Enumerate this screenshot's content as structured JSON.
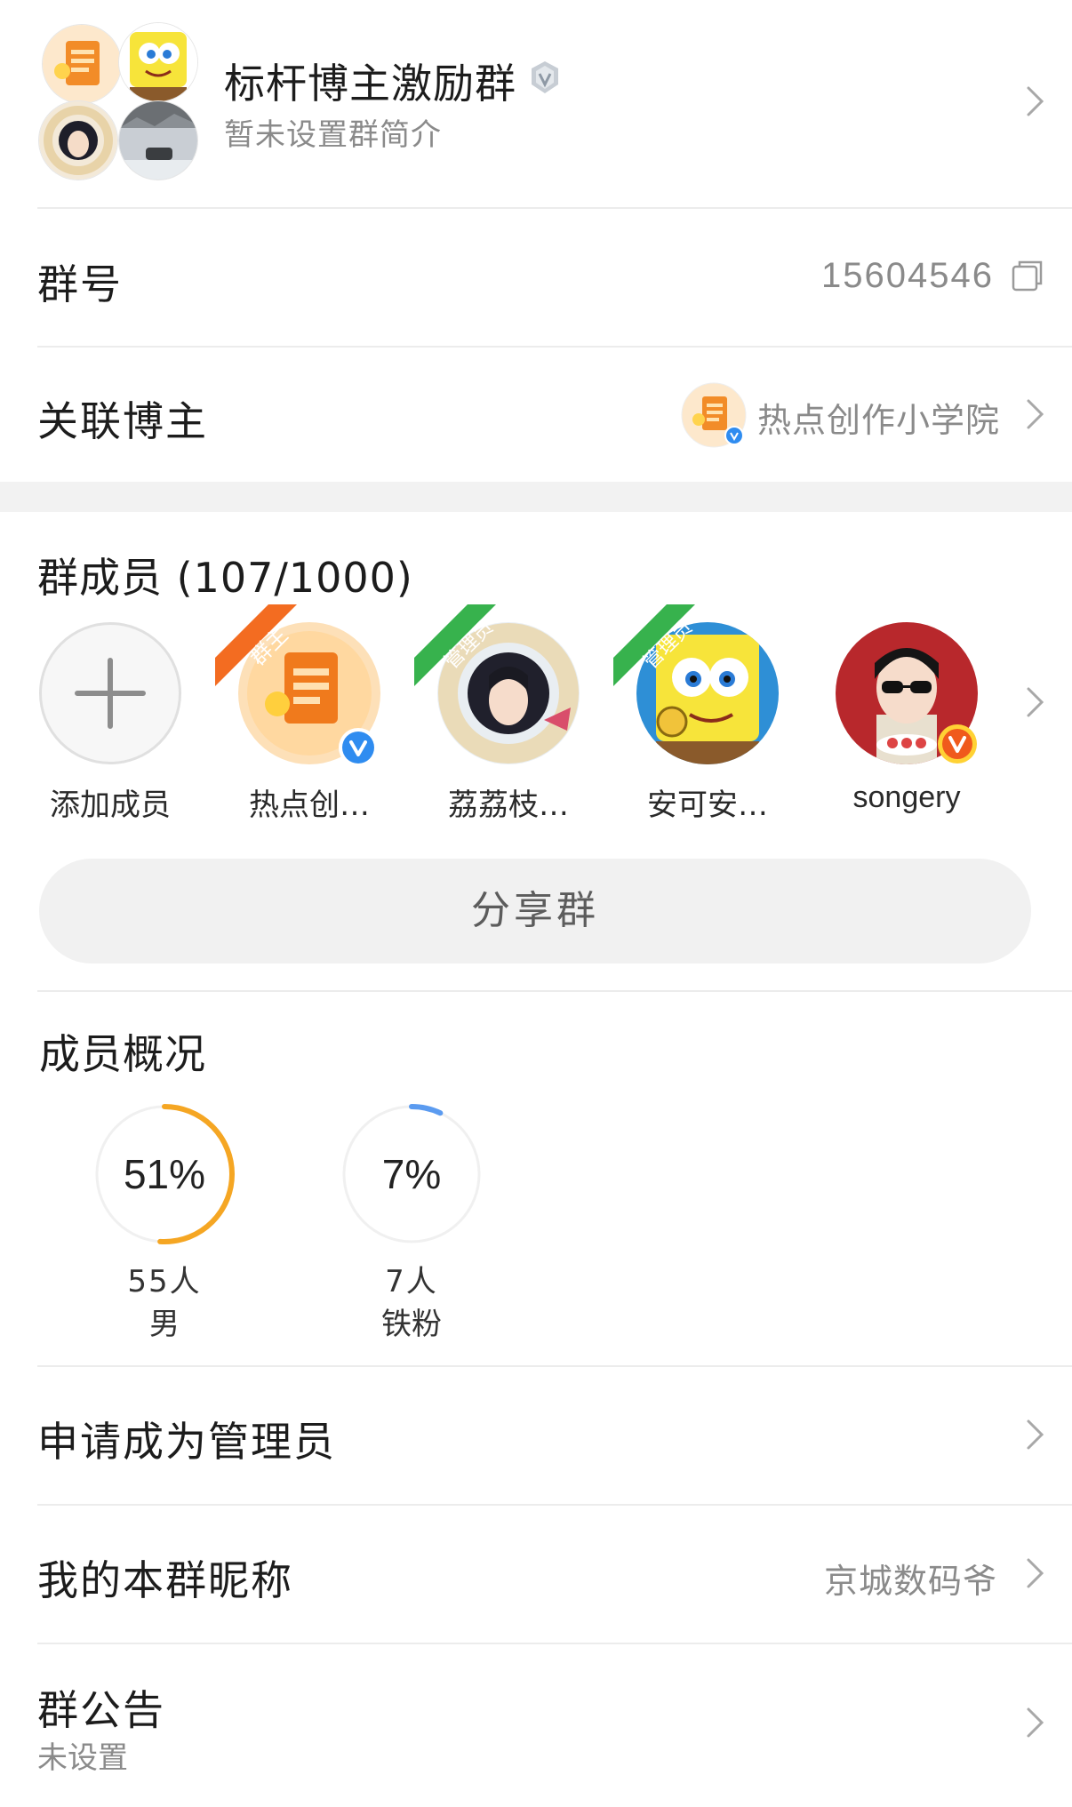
{
  "header": {
    "group_name": "标杆博主激励群",
    "group_desc": "暂未设置群简介"
  },
  "group_number": {
    "label": "群号",
    "value": "15604546"
  },
  "linked_blogger": {
    "label": "关联博主",
    "value": "热点创作小学院"
  },
  "members": {
    "title": "群成员 (107/1000)",
    "add_label": "添加成员",
    "list": [
      {
        "name": "热点创…",
        "role": "群主"
      },
      {
        "name": "荔荔枝…",
        "role": "管理员"
      },
      {
        "name": "安可安…",
        "role": "管理员"
      },
      {
        "name": "songery",
        "role": ""
      }
    ],
    "share_label": "分享群"
  },
  "overview": {
    "title": "成员概况",
    "stats": [
      {
        "percent": "51%",
        "value": 0.51,
        "count": "55人",
        "label": "男",
        "color": "#f5a623"
      },
      {
        "percent": "7%",
        "value": 0.07,
        "count": "7人",
        "label": "铁粉",
        "color": "#5b9bf0"
      }
    ]
  },
  "apply_admin": {
    "label": "申请成为管理员"
  },
  "my_nickname": {
    "label": "我的本群昵称",
    "value": "京城数码爷"
  },
  "notice": {
    "label": "群公告",
    "value": "未设置"
  }
}
